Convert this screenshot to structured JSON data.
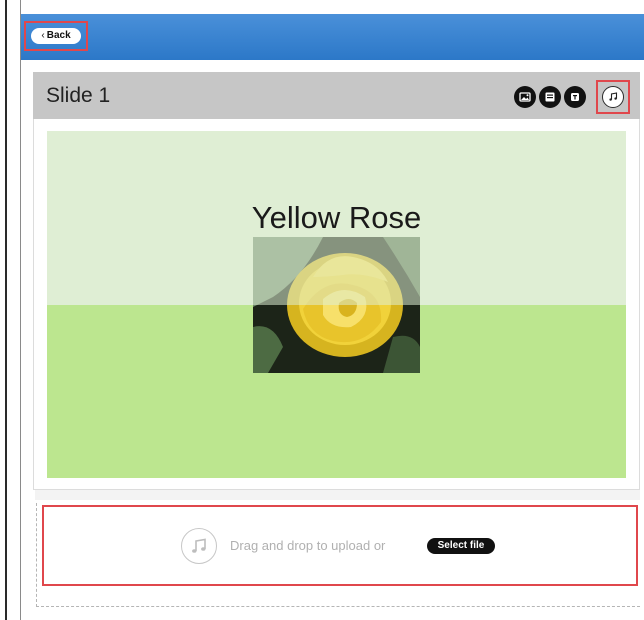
{
  "header": {
    "back_label": "Back",
    "back_icon": "chevron-left-icon",
    "bar_color": "#3a84d1"
  },
  "slide": {
    "title": "Slide 1",
    "heading": "Yellow Rose",
    "image_subject": "yellow rose",
    "top_color": "#dfeed4",
    "bottom_color": "#bce68f"
  },
  "toolbar": {
    "items": [
      {
        "icon": "image-icon"
      },
      {
        "icon": "layout-icon"
      },
      {
        "icon": "text-icon"
      },
      {
        "icon": "music-note-icon",
        "active": true
      }
    ]
  },
  "upload": {
    "icon": "music-note-icon",
    "text": "Drag and drop to upload or",
    "button_label": "Select file"
  },
  "highlight_color": "#e0474c"
}
